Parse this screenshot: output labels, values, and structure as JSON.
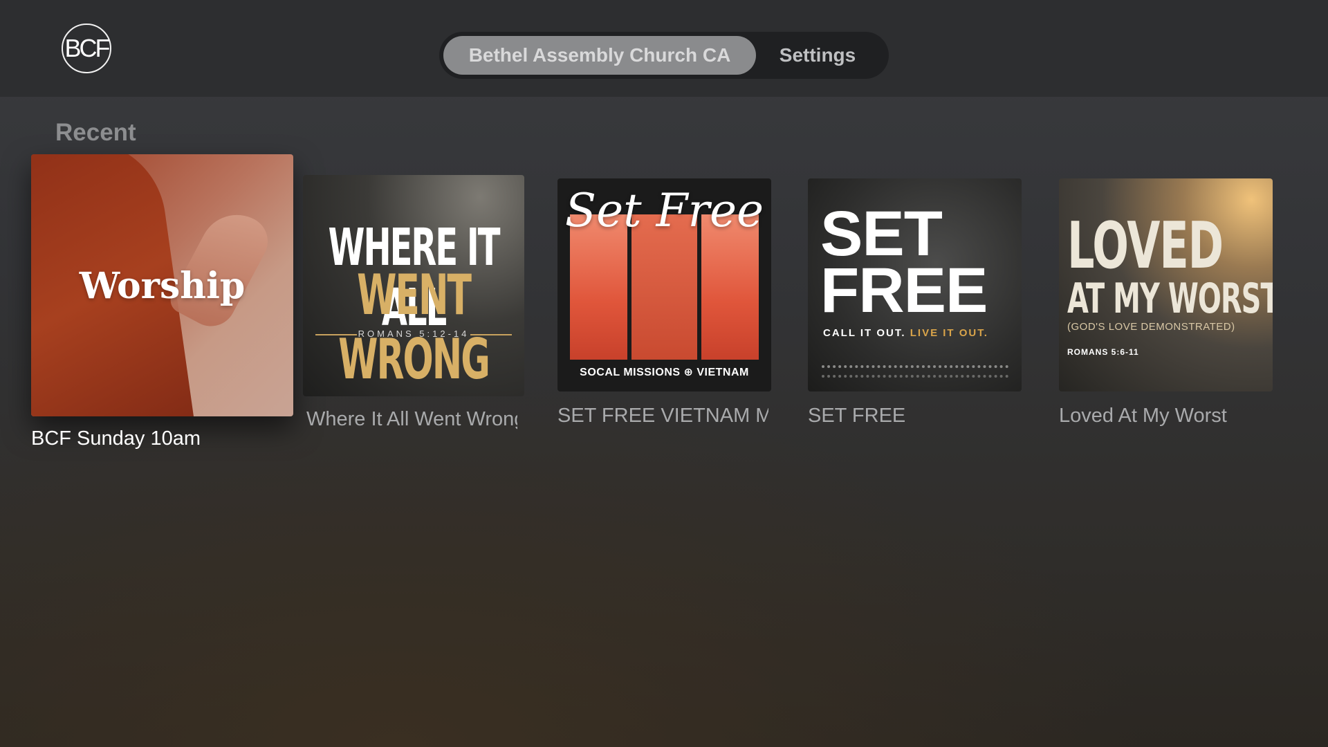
{
  "header": {
    "logo_text": "BCF",
    "tabs": [
      {
        "label": "Bethel Assembly Church CA",
        "selected": true
      },
      {
        "label": "Settings",
        "selected": false
      }
    ]
  },
  "recent": {
    "title": "Recent",
    "items": [
      {
        "caption": "BCF Sunday 10am",
        "focused": true,
        "art_text": "Worship"
      },
      {
        "caption": "Where It All Went Wrong",
        "art_line1": "WHERE IT ALL",
        "art_line2": "WENT WRONG",
        "art_ref": "ROMANS 5:12-14"
      },
      {
        "caption": "SET FREE VIETNAM MISSIONS",
        "art_script": "Set Free",
        "art_footer": "SOCAL MISSIONS ⊕ VIETNAM"
      },
      {
        "caption": "SET FREE",
        "art_line1": "SET",
        "art_line2": "FREE",
        "art_tag_a": "CALL IT OUT.",
        "art_tag_b": "LIVE IT OUT."
      },
      {
        "caption": "Loved At My Worst",
        "art_line1": "LOVED",
        "art_line2": "AT MY WORST",
        "art_sub": "(GOD'S LOVE DEMONSTRATED)",
        "art_ref": "ROMANS 5:6-11"
      }
    ]
  },
  "colors": {
    "topbar": "#2d2e30",
    "selected_tab": "#8a8b8d",
    "accent_gold": "#d8b066"
  }
}
